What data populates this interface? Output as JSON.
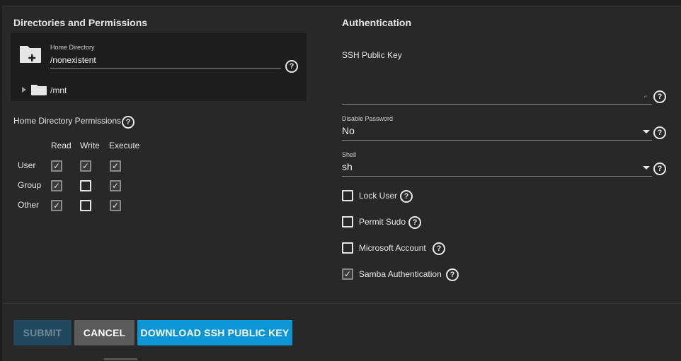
{
  "left": {
    "section_title": "Directories and Permissions",
    "home_directory_label": "Home Directory",
    "home_directory_value": "/nonexistent",
    "tree_item": "/mnt",
    "permissions_label": "Home Directory Permissions",
    "columns": [
      "Read",
      "Write",
      "Execute"
    ],
    "rows": [
      {
        "label": "User",
        "read": true,
        "write": true,
        "execute": true
      },
      {
        "label": "Group",
        "read": true,
        "write": false,
        "execute": true
      },
      {
        "label": "Other",
        "read": true,
        "write": false,
        "execute": true
      }
    ]
  },
  "right": {
    "section_title": "Authentication",
    "ssh_key_label": "SSH Public Key",
    "ssh_key_value": "",
    "disable_password_label": "Disable Password",
    "disable_password_value": "No",
    "shell_label": "Shell",
    "shell_value": "sh",
    "checkboxes": [
      {
        "label": "Lock User",
        "checked": false
      },
      {
        "label": "Permit Sudo",
        "checked": false
      },
      {
        "label": "Microsoft Account",
        "checked": false
      },
      {
        "label": "Samba Authentication",
        "checked": true
      }
    ]
  },
  "buttons": {
    "submit": "SUBMIT",
    "cancel": "CANCEL",
    "download": "DOWNLOAD SSH PUBLIC KEY"
  },
  "icons": {
    "help": "?",
    "check": "✓"
  },
  "colors": {
    "accent": "#0d96d6",
    "submit_disabled": "#21485e",
    "cancel": "#5a5a5a",
    "background": "#282828",
    "panel": "#1d1d1d"
  }
}
